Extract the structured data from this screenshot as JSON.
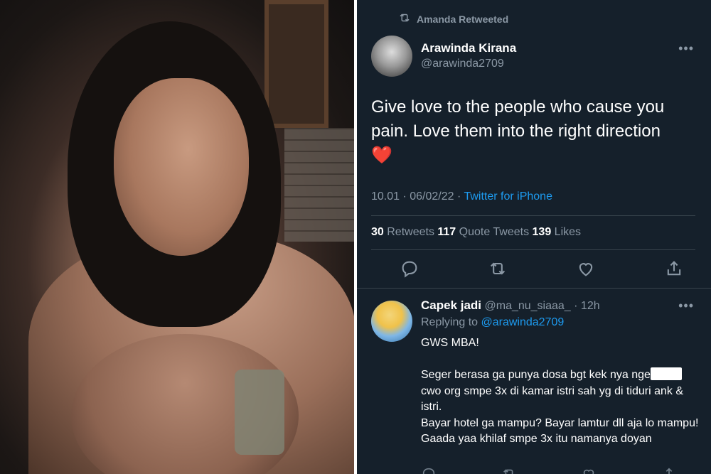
{
  "retweet_banner": {
    "text": "Amanda Retweeted"
  },
  "tweet": {
    "display_name": "Arawinda Kirana",
    "handle": "@arawinda2709",
    "text": "Give love to the people who cause you pain. Love them into the right direction",
    "emoji": "❤️",
    "timestamp": "10.01 · 06/02/22 · ",
    "source": "Twitter for iPhone",
    "retweets_count": "30",
    "retweets_label": " Retweets  ",
    "quotes_count": "117",
    "quotes_label": " Quote Tweets  ",
    "likes_count": "139",
    "likes_label": " Likes",
    "more_label": "•••"
  },
  "reply": {
    "display_name": "Capek jadi",
    "handle_time": " @ma_nu_siaaa_ · 12h",
    "replying_prefix": "Replying to ",
    "replying_handle": "@arawinda2709",
    "line1": "GWS MBA!",
    "line2_before": "Seger berasa ga punya dosa bgt kek nya nge",
    "line2_after": "\ncwo org smpe 3x di kamar istri sah yg di tiduri ank & istri.",
    "line3": "Bayar hotel ga mampu? Bayar lamtur dll aja lo mampu! Gaada yaa khilaf smpe 3x itu namanya doyan",
    "more_label": "•••"
  },
  "colors": {
    "background": "#15202b",
    "accent": "#1d9bf0",
    "muted": "#8b98a5",
    "heart": "#e0245e"
  },
  "icons": [
    "retweet-icon",
    "reply-icon",
    "like-icon",
    "share-icon",
    "more-icon"
  ]
}
